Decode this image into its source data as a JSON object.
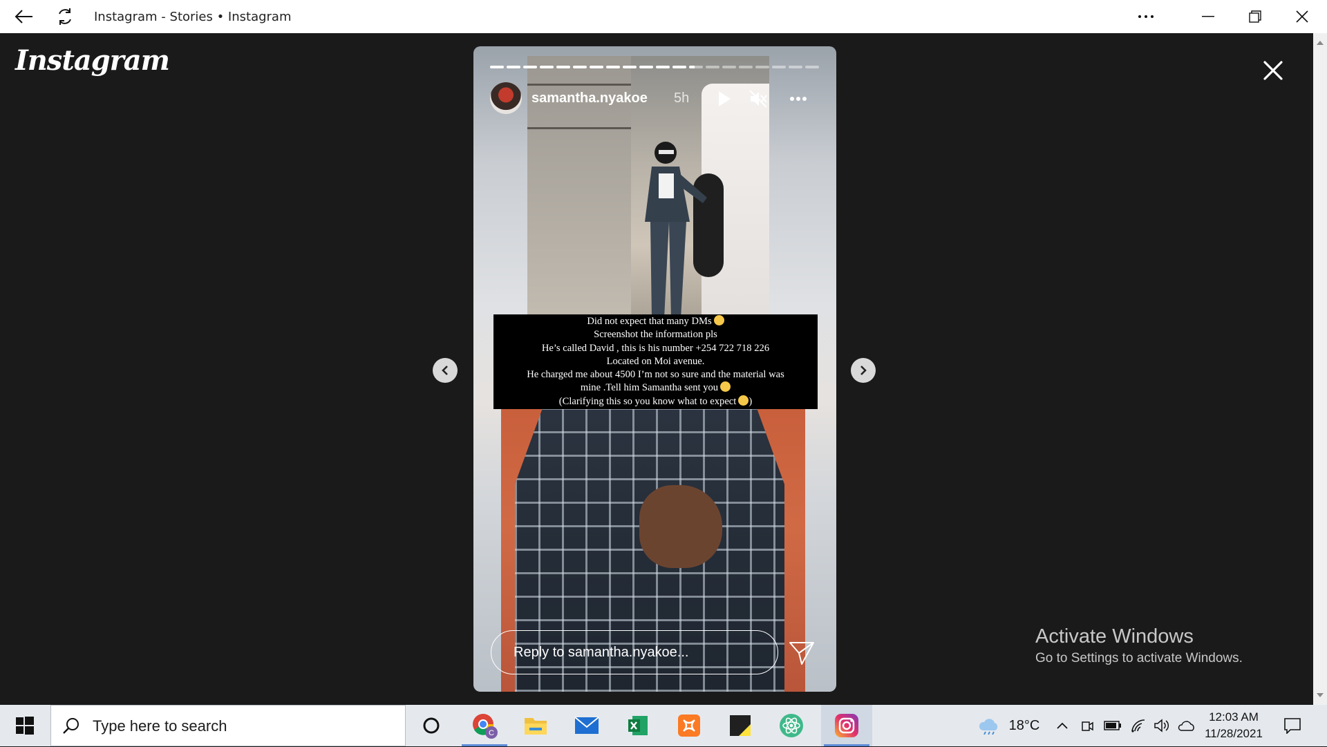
{
  "window": {
    "title": "Instagram - Stories • Instagram"
  },
  "app": {
    "logo_text": "Instagram"
  },
  "story": {
    "username": "samantha.nyakoe",
    "time_ago": "5h",
    "progress": {
      "segments": 20,
      "completed": 12,
      "current_fraction": 0.4
    },
    "caption_lines": [
      "Did not expect that many DMs",
      "Screenshot the information pls",
      "He’s called David , this is his number +254 722 718 226",
      "Located on Moi avenue.",
      "He charged me about 4500 I’m not so sure and the material was",
      "mine .Tell him Samantha sent you",
      "(Clarifying this so you know what to expect"
    ],
    "caption_line7_suffix": ")",
    "reply_placeholder": "Reply to samantha.nyakoe..."
  },
  "watermark": {
    "line1": "Activate Windows",
    "line2": "Go to Settings to activate Windows."
  },
  "taskbar": {
    "search_placeholder": "Type here to search",
    "apps": [
      "chrome-icon",
      "file-explorer-icon",
      "mail-icon",
      "excel-icon",
      "xampp-icon",
      "sticky-notes-icon",
      "atom-icon",
      "instagram-icon"
    ],
    "weather_temp": "18°C",
    "time": "12:03 AM",
    "date": "11/28/2021"
  },
  "colors": {
    "background": "#1a1a1a",
    "taskbar": "#e5e9ee",
    "active_indicator": "#5c8ad6"
  }
}
